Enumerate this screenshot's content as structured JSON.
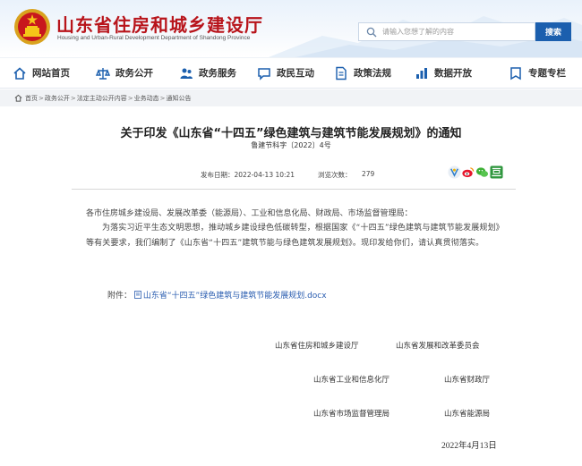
{
  "header": {
    "title": "山东省住房和城乡建设厅",
    "subtitle": "Housing and Urban-Rural Development Department of Shandong Province",
    "search_placeholder": "请输入您想了解的内容",
    "search_button": "搜索",
    "brand_color": "#b8141b",
    "accent_color": "#1b5fae"
  },
  "nav": {
    "items": [
      {
        "label": "网站首页",
        "icon": "home-icon"
      },
      {
        "label": "政务公开",
        "icon": "scale-icon"
      },
      {
        "label": "政务服务",
        "icon": "people-icon"
      },
      {
        "label": "政民互动",
        "icon": "chat-icon"
      },
      {
        "label": "政策法规",
        "icon": "document-icon"
      },
      {
        "label": "数据开放",
        "icon": "chart-icon"
      },
      {
        "label": "专题专栏",
        "icon": "topic-icon"
      }
    ]
  },
  "breadcrumb": [
    "首页",
    "政务公开",
    "法定主动公开内容",
    "业务动态",
    "通知公告"
  ],
  "article": {
    "title": "关于印发《山东省“十四五”绿色建筑与建筑节能发展规划》的通知",
    "doc_number": "鲁建节科字〔2022〕4号",
    "publish_label": "发布日期：2022-04-13 10:21",
    "views_label": "浏览次数：",
    "views": "279",
    "greeting": "各市住房城乡建设局、发展改革委（能源局）、工业和信息化局、财政局、市场监督管理局：",
    "paragraph": "为落实习近平生态文明思想，推动城乡建设绿色低碳转型，根据国家《“十四五”绿色建筑与建筑节能发展规划》等有关要求，我们编制了《山东省“十四五”建筑节能与绿色建筑发展规划》。现印发给你们，请认真贯彻落实。",
    "attachment_label": "附件：",
    "attachment_file": "山东省“十四五”绿色建筑与建筑节能发展规划.docx",
    "signatures": [
      "山东省住房和城乡建设厅",
      "山东省发展和改革委员会",
      "山东省工业和信息化厅",
      "山东省财政厅",
      "山东省市场监督管理局",
      "山东省能源局"
    ],
    "date": "2022年4月13日"
  }
}
